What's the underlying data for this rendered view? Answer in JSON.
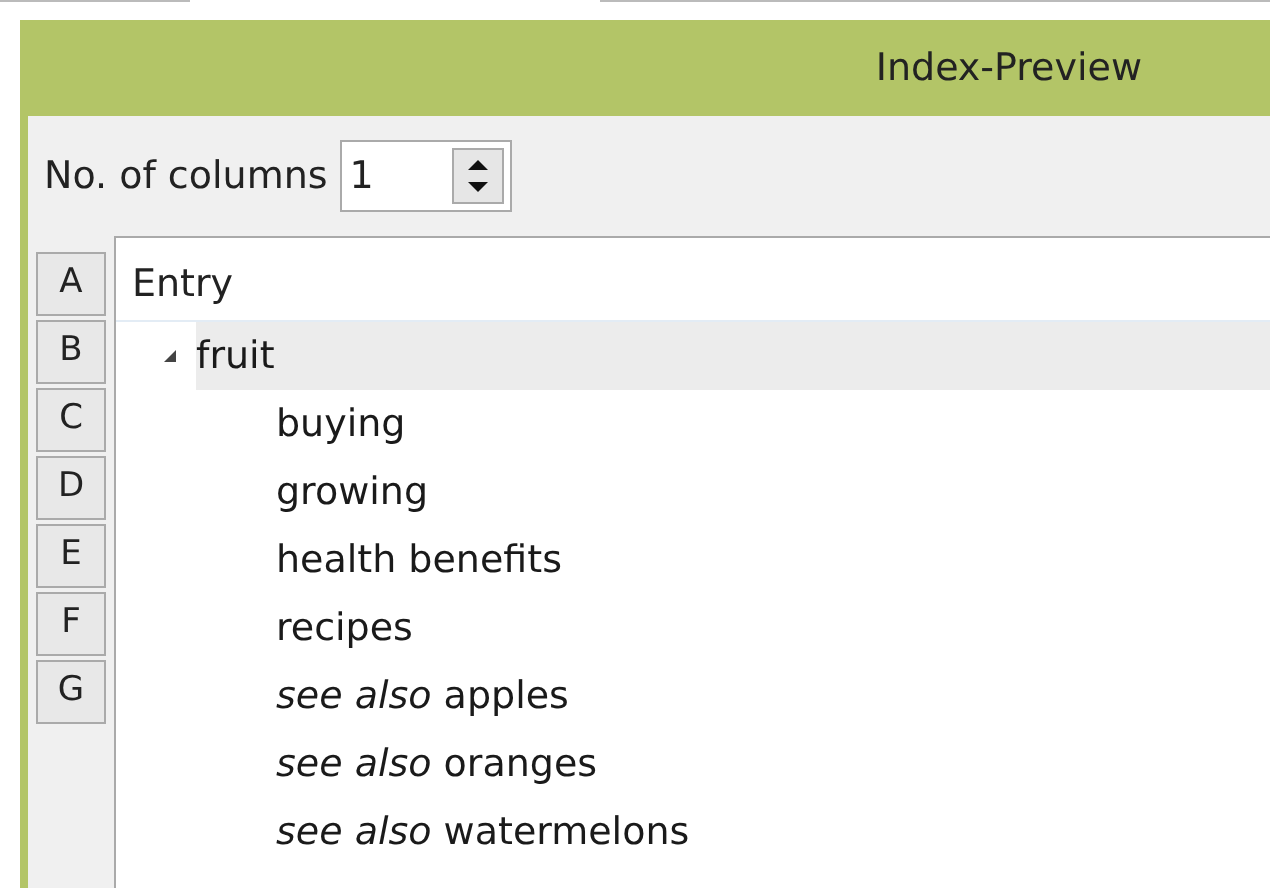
{
  "panel": {
    "title": "Index-Preview"
  },
  "columns_control": {
    "label": "No. of columns",
    "value": "1"
  },
  "letters": [
    {
      "label": "A"
    },
    {
      "label": "B"
    },
    {
      "label": "C"
    },
    {
      "label": "D"
    },
    {
      "label": "E"
    },
    {
      "label": "F"
    },
    {
      "label": "G"
    }
  ],
  "tree": {
    "column": "Entry",
    "items": [
      {
        "label": "fruit",
        "expanded": true,
        "selected": true,
        "children": [
          {
            "label": "buying"
          },
          {
            "label": "growing"
          },
          {
            "label": "health benefits"
          },
          {
            "label": "recipes"
          },
          {
            "label": "*see also* apples"
          },
          {
            "label": "*see also* oranges"
          },
          {
            "label": "*see also* watermelons"
          }
        ]
      }
    ]
  }
}
